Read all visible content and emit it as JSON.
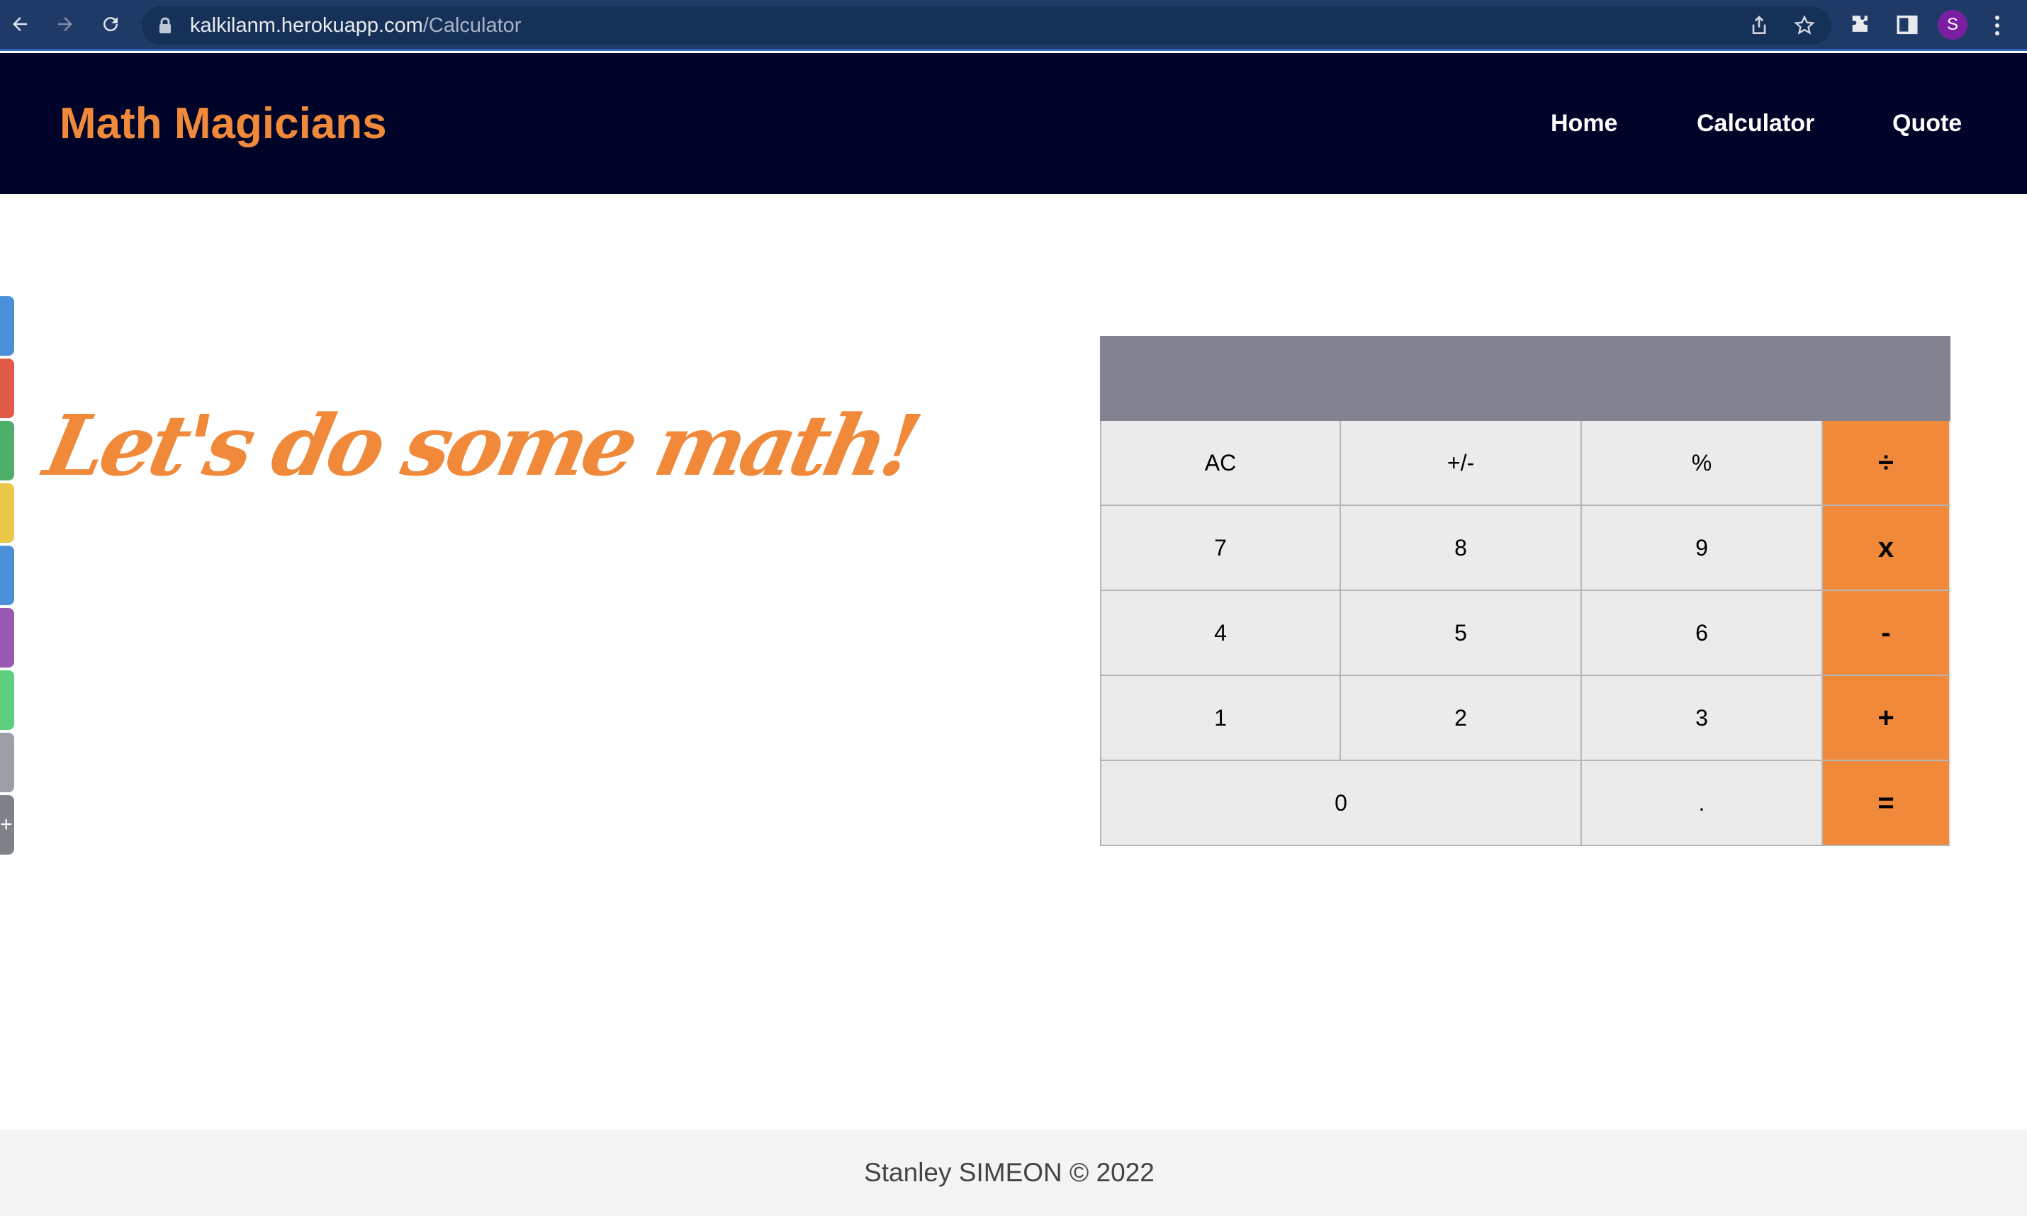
{
  "browser": {
    "url_domain": "kalkilanm.herokuapp.com",
    "url_path": "/Calculator",
    "avatar_letter": "S"
  },
  "header": {
    "brand": "Math Magicians",
    "nav": [
      {
        "label": "Home"
      },
      {
        "label": "Calculator"
      },
      {
        "label": "Quote"
      }
    ]
  },
  "main": {
    "headline": "Let's do some math!"
  },
  "calculator": {
    "display": "",
    "rows": [
      [
        "AC",
        "+/-",
        "%",
        "÷"
      ],
      [
        "7",
        "8",
        "9",
        "x"
      ],
      [
        "4",
        "5",
        "6",
        "-"
      ],
      [
        "1",
        "2",
        "3",
        "+"
      ],
      [
        "0",
        ".",
        "="
      ]
    ]
  },
  "footer": {
    "text": "Stanley SIMEON © 2022"
  },
  "side_tabs": {
    "plus_label": "+",
    "colors": [
      "#4a90d9",
      "#e05a47",
      "#4caf6a",
      "#eac84a",
      "#4a90d9",
      "#9b59b6",
      "#5ccf7f",
      "#9aa0a6",
      "#7d8388"
    ]
  },
  "colors": {
    "accent": "#f0893a",
    "header_bg": "#000428",
    "display_bg": "#828291",
    "key_bg": "#ebebeb",
    "footer_bg": "#f4f4f4"
  }
}
